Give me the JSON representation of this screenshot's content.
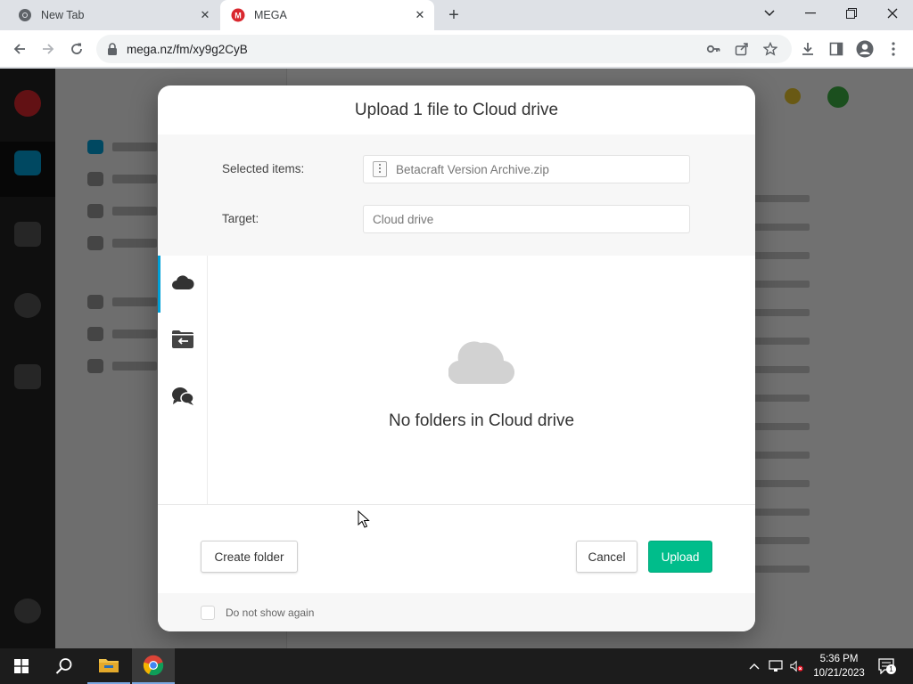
{
  "browser": {
    "tabs": [
      {
        "title": "New Tab",
        "favicon": "chrome-icon",
        "active": false
      },
      {
        "title": "MEGA",
        "favicon": "mega-icon",
        "active": true
      }
    ],
    "url": "mega.nz/fm/xy9g2CyB"
  },
  "dialog": {
    "title": "Upload 1 file to Cloud drive",
    "selected_label": "Selected items:",
    "selected_value": "Betacraft Version Archive.zip",
    "target_label": "Target:",
    "target_value": "Cloud drive",
    "side_tabs": [
      {
        "name": "cloud-drive",
        "icon": "cloud-icon",
        "active": true
      },
      {
        "name": "incoming-shares",
        "icon": "folder-share-icon",
        "active": false
      },
      {
        "name": "chats",
        "icon": "chat-bubbles-icon",
        "active": false
      }
    ],
    "empty_message": "No folders in Cloud drive",
    "create_folder": "Create folder",
    "cancel": "Cancel",
    "upload": "Upload",
    "dont_show": "Do not show again"
  },
  "taskbar": {
    "time": "5:36 PM",
    "date": "10/21/2023",
    "notifications": "1"
  },
  "colors": {
    "accent": "#00a0d7",
    "upload_button": "#00bd8b",
    "mega_red": "#d9272e"
  }
}
